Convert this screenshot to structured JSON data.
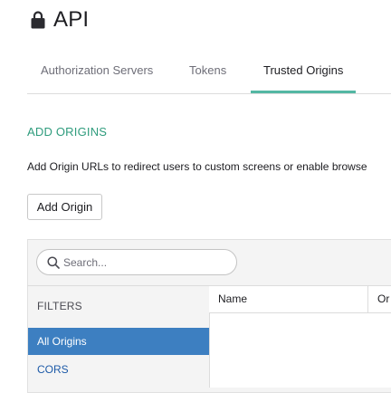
{
  "header": {
    "title": "API",
    "icon": "lock-icon"
  },
  "tabs": [
    {
      "label": "Authorization Servers",
      "active": false
    },
    {
      "label": "Tokens",
      "active": false
    },
    {
      "label": "Trusted Origins",
      "active": true
    }
  ],
  "section": {
    "heading": "ADD ORIGINS",
    "description": "Add Origin URLs to redirect users to custom screens or enable browse",
    "add_button_label": "Add Origin"
  },
  "search": {
    "placeholder": "Search...",
    "value": ""
  },
  "filters": {
    "label": "FILTERS",
    "items": [
      {
        "label": "All Origins",
        "selected": true
      },
      {
        "label": "CORS",
        "selected": false
      }
    ]
  },
  "table": {
    "columns": [
      "Name",
      "Or"
    ]
  },
  "colors": {
    "accent": "#53b7a3",
    "heading": "#2f9c7d",
    "selected_filter": "#3d7fc1",
    "link": "#1d5aa8"
  }
}
